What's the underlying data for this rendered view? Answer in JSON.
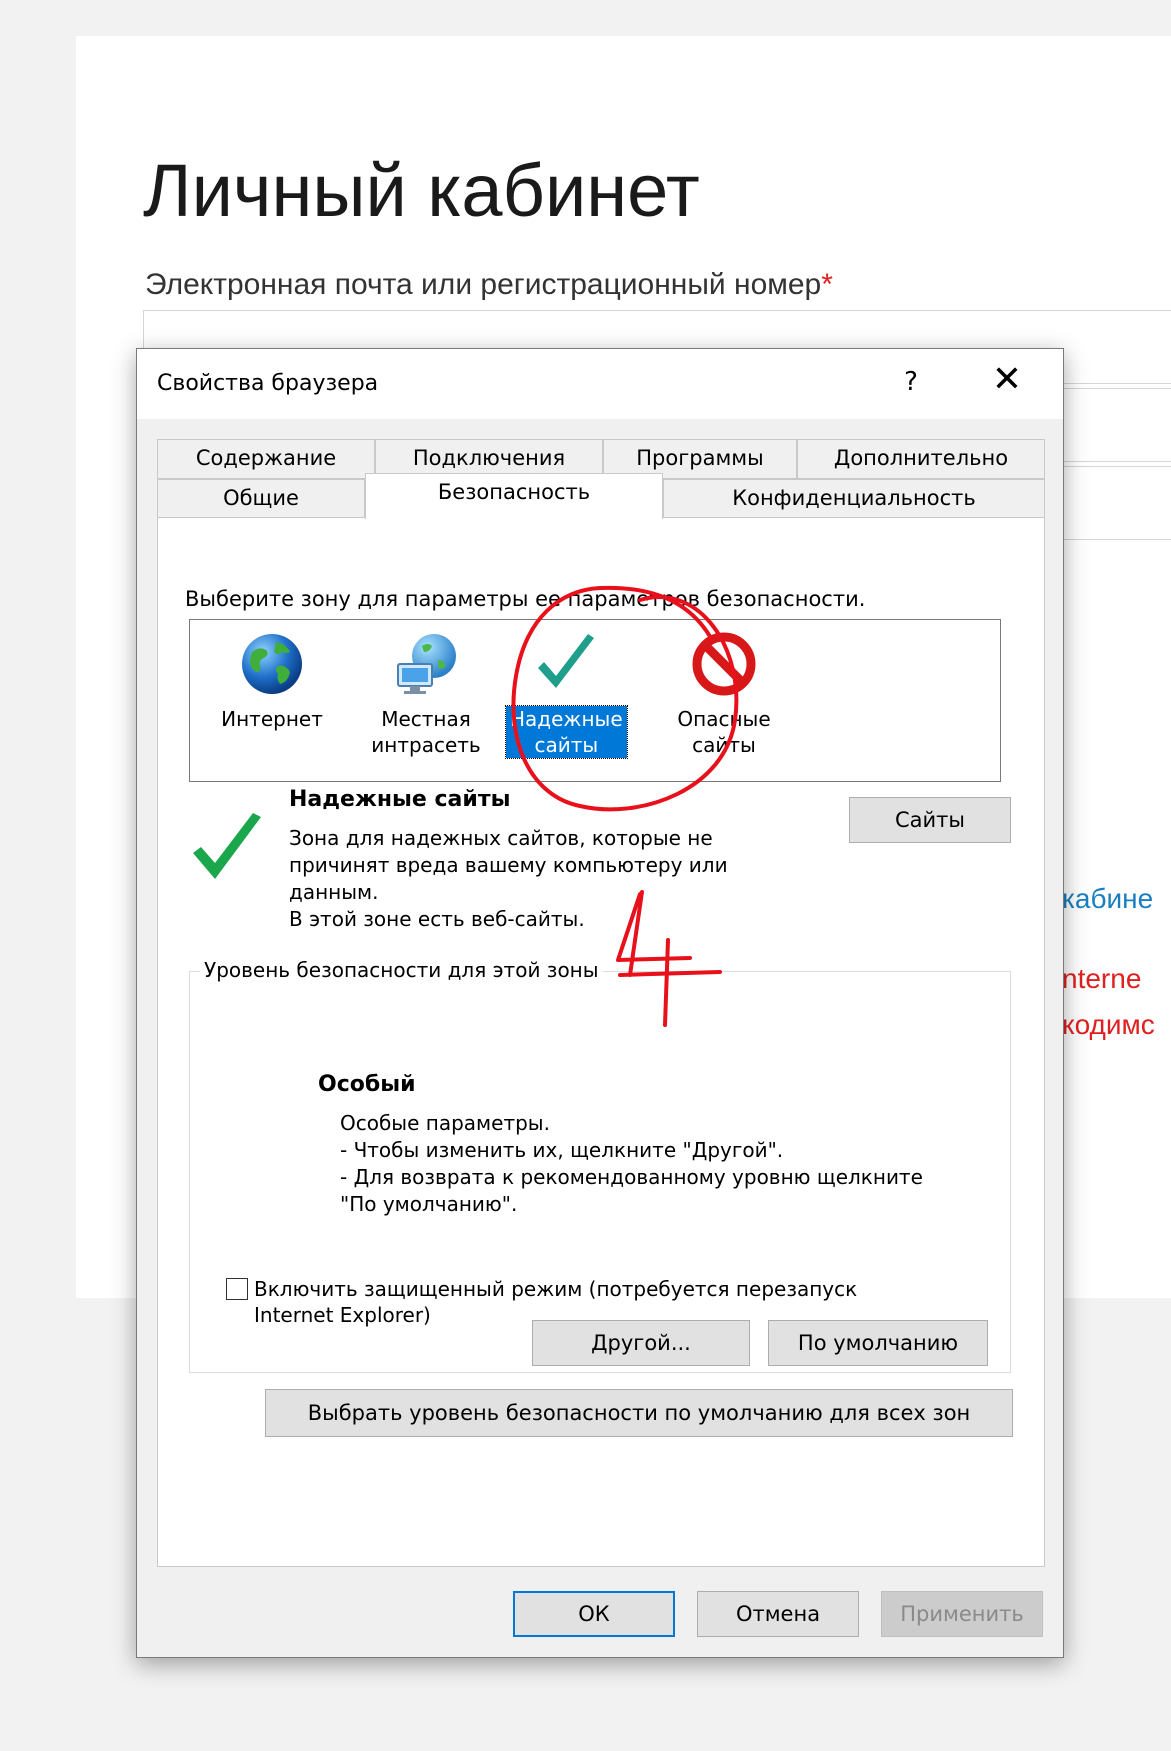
{
  "page": {
    "title": "Личный кабинет",
    "field_label": "Электронная почта или регистрационный номер",
    "required_mark": "*",
    "partial_link": "кабине",
    "partial_red_1": "nterne",
    "partial_red_2": "кодимс"
  },
  "dialog": {
    "title": "Свойства браузера",
    "help_glyph": "?",
    "close_glyph": "✕",
    "tabs_row1": [
      "Содержание",
      "Подключения",
      "Программы",
      "Дополнительно"
    ],
    "tabs_row2": [
      "Общие",
      "Безопасность",
      "Конфиденциальность"
    ],
    "active_tab": "Безопасность",
    "zone_prompt": "Выберите зону для параметры ее параметров безопасности.",
    "zones": [
      {
        "icon": "globe-icon",
        "line1": "Интернет",
        "line2": ""
      },
      {
        "icon": "intranet-icon",
        "line1": "Местная",
        "line2": "интрасеть"
      },
      {
        "icon": "checkmark-icon",
        "line1": "Надежные",
        "line2": "сайты",
        "selected": true
      },
      {
        "icon": "forbidden-icon",
        "line1": "Опасные",
        "line2": "сайты"
      }
    ],
    "zone_desc": {
      "title": "Надежные сайты",
      "lines": [
        "Зона для надежных сайтов, которые не",
        "причинят вреда вашему компьютеру или",
        "данным.",
        "В этой зоне есть веб-сайты."
      ]
    },
    "sites_button": "Сайты",
    "level_group": {
      "legend": "Уровень безопасности для этой зоны",
      "level_title": "Особый",
      "level_lines": [
        "Особые параметры.",
        "- Чтобы изменить их, щелкните \"Другой\".",
        "- Для возврата к рекомендованному уровню щелкните",
        "\"По умолчанию\"."
      ],
      "protected_mode_line1": "Включить защищенный режим (потребуется перезапуск",
      "protected_mode_line2": "Internet Explorer)",
      "protected_mode_checked": false,
      "custom_button": "Другой...",
      "default_button": "По умолчанию"
    },
    "reset_all_button": "Выбрать уровень безопасности по умолчанию для всех зон",
    "ok_button": "ОК",
    "cancel_button": "Отмена",
    "apply_button": "Применить"
  },
  "annotation": {
    "handwritten_text": "4+",
    "color": "#e8101a"
  },
  "colors": {
    "selection_blue": "#0078d7",
    "check_green": "#1aa64a",
    "check_teal": "#1f9e8c",
    "link_blue": "#1a7fc1",
    "required_red": "#e02020"
  }
}
